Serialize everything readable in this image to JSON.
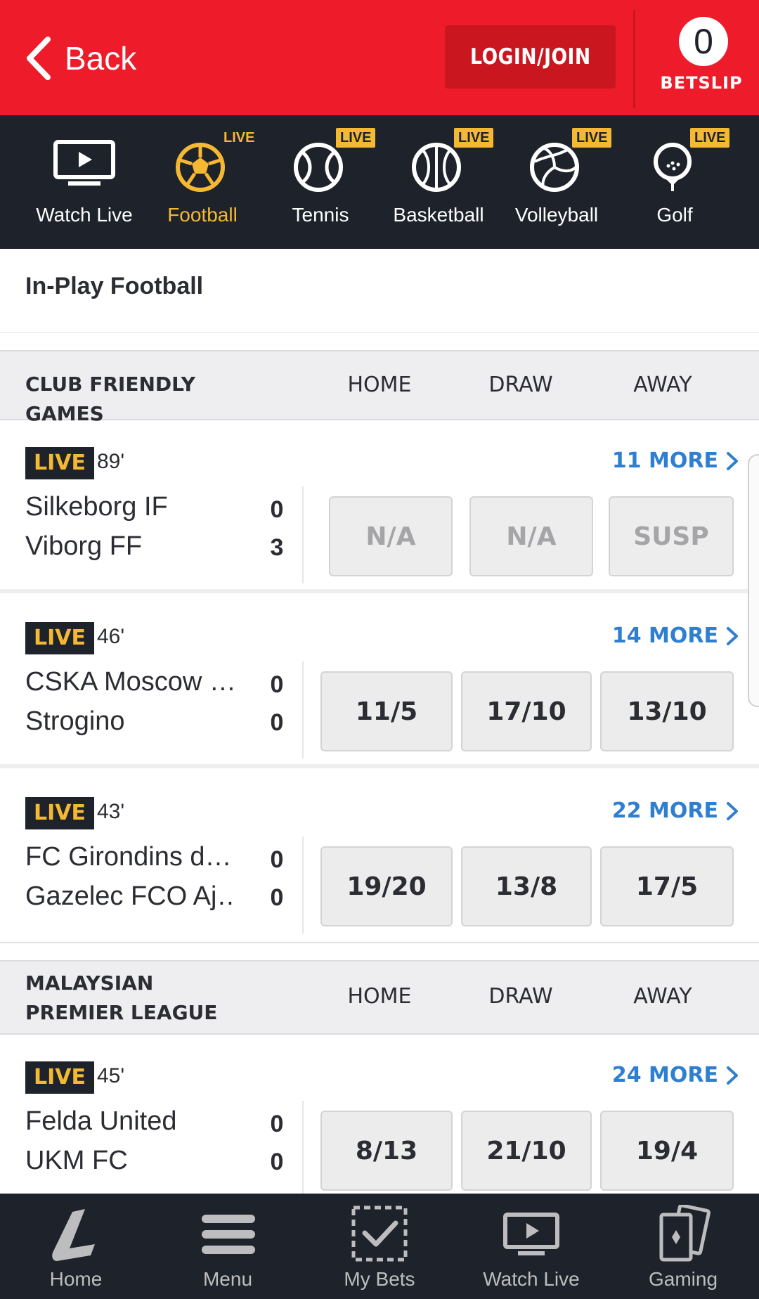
{
  "header": {
    "back_label": "Back",
    "login_label": "LOGIN/JOIN",
    "betslip_count": "0",
    "betslip_label": "BETSLIP"
  },
  "colors": {
    "brand_red": "#ee1c2a",
    "dark": "#1e232b",
    "live_yellow": "#f5b833",
    "link_blue": "#2f7fd1"
  },
  "sports_nav": [
    {
      "label": "Watch Live",
      "icon": "tv-icon",
      "live": ""
    },
    {
      "label": "Football",
      "icon": "football-icon",
      "live": "LIVE",
      "active": true
    },
    {
      "label": "Tennis",
      "icon": "tennis-ball-icon",
      "live": "LIVE"
    },
    {
      "label": "Basketball",
      "icon": "basketball-icon",
      "live": "LIVE"
    },
    {
      "label": "Volleyball",
      "icon": "volleyball-icon",
      "live": "LIVE"
    },
    {
      "label": "Golf",
      "icon": "golf-ball-icon",
      "live": "LIVE"
    }
  ],
  "page_title": "In-Play Football",
  "leagues": [
    {
      "name": "CLUB FRIENDLY GAMES",
      "columns": [
        "HOME",
        "DRAW",
        "AWAY"
      ],
      "events": [
        {
          "live": "LIVE",
          "time": "89'",
          "more": "11 MORE",
          "home": "Silkeborg IF",
          "away": "Viborg FF",
          "home_score": "0",
          "away_score": "3",
          "odds": [
            "N/A",
            "N/A",
            "SUSP"
          ]
        },
        {
          "live": "LIVE",
          "time": "46'",
          "more": "14 MORE",
          "home": "CSKA Moscow …",
          "away": "Strogino",
          "home_score": "0",
          "away_score": "0",
          "odds": [
            "11/5",
            "17/10",
            "13/10"
          ]
        },
        {
          "live": "LIVE",
          "time": "43'",
          "more": "22 MORE",
          "home": "FC Girondins d…",
          "away": "Gazelec FCO Aj…",
          "home_score": "0",
          "away_score": "0",
          "odds": [
            "19/20",
            "13/8",
            "17/5"
          ]
        }
      ]
    },
    {
      "name": "MALAYSIAN PREMIER LEAGUE",
      "columns": [
        "HOME",
        "DRAW",
        "AWAY"
      ],
      "events": [
        {
          "live": "LIVE",
          "time": "45'",
          "more": "24 MORE",
          "home": "Felda United",
          "away": "UKM FC",
          "home_score": "0",
          "away_score": "0",
          "odds": [
            "8/13",
            "21/10",
            "19/4"
          ]
        }
      ]
    }
  ],
  "bottom_nav": [
    {
      "label": "Home",
      "icon": "ladbrokes-logo-icon"
    },
    {
      "label": "Menu",
      "icon": "hamburger-menu-icon"
    },
    {
      "label": "My Bets",
      "icon": "betslip-check-icon"
    },
    {
      "label": "Watch Live",
      "icon": "tv-icon"
    },
    {
      "label": "Gaming",
      "icon": "playing-cards-icon"
    }
  ]
}
